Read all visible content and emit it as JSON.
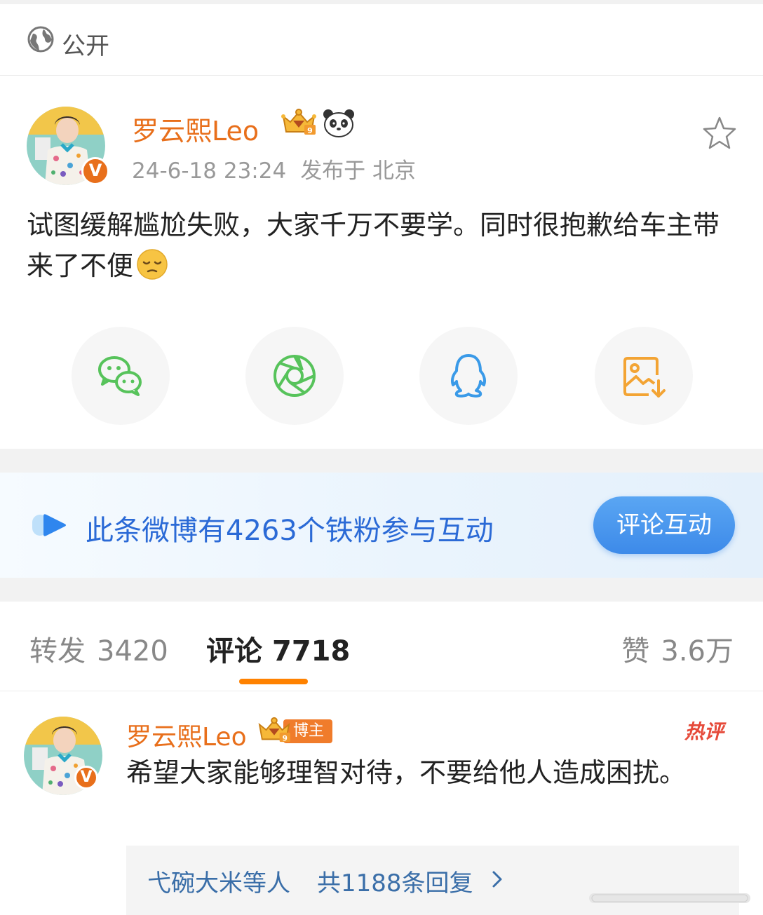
{
  "visibility": {
    "label": "公开",
    "icon": "globe-icon"
  },
  "post": {
    "author": "罗云熙Leo",
    "timestamp": "24-6-18 23:24",
    "location": "发布于 北京",
    "text": "试图缓解尴尬失败，大家千万不要学。同时很抱歉给车主带来了不便",
    "emoji": "pensive-face",
    "verified_badge": "V",
    "icons": [
      "crown-badge-icon",
      "panda-icon",
      "star-icon"
    ]
  },
  "share": [
    {
      "name": "wechat-icon",
      "color": "#57c35b"
    },
    {
      "name": "moments-icon",
      "color": "#57c35b"
    },
    {
      "name": "qq-icon",
      "color": "#3a9ae8"
    },
    {
      "name": "save-image-icon",
      "color": "#f3a434"
    }
  ],
  "fans_banner": {
    "text": "此条微博有4263个铁粉参与互动",
    "button": "评论互动"
  },
  "tabs": {
    "repost": {
      "label": "转发",
      "count": "3420"
    },
    "comments": {
      "label": "评论",
      "count": "7718"
    },
    "likes": {
      "label": "赞",
      "count": "3.6万"
    },
    "active": "comments"
  },
  "comment": {
    "author": "罗云熙Leo",
    "role_badge": "博主",
    "hot_label": "热评",
    "text": "希望大家能够理智对待，不要给他人造成困扰。",
    "verified_badge": "V",
    "replies": {
      "who": "弋碗大米等人",
      "count": "共1188条回复"
    }
  },
  "colors": {
    "accent_orange": "#ff8200",
    "name_orange": "#e86f1b",
    "link_blue": "#2b6ad6",
    "button_blue": "#3d8ae9"
  }
}
